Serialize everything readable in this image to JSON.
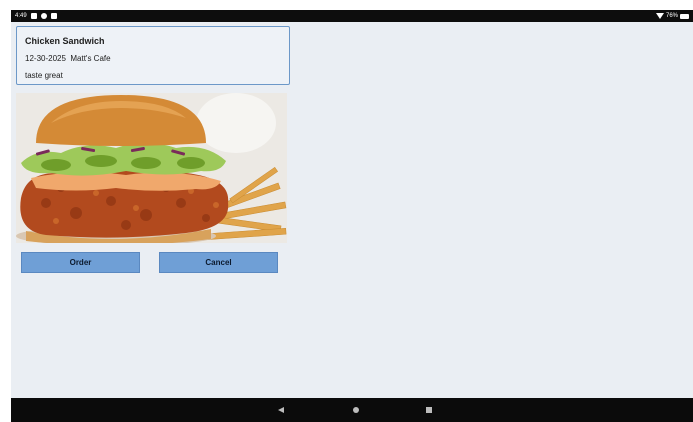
{
  "status_bar": {
    "time": "4:49",
    "battery": "76%",
    "icons": [
      "download-icon",
      "settings-icon",
      "notification-icon",
      "wifi-icon",
      "battery-icon"
    ]
  },
  "item": {
    "title": "Chicken Sandwich",
    "date": "12-30-2025",
    "place": "Matt's Cafe",
    "description": "taste great",
    "image_subject": "chicken-sandwich-with-fries"
  },
  "actions": {
    "order_label": "Order",
    "cancel_label": "Cancel"
  },
  "nav": {
    "icons": [
      "back-icon",
      "home-icon",
      "recents-icon"
    ]
  },
  "colors": {
    "background": "#eaeef3",
    "card_border": "#6c98c8",
    "button": "#6f9fd6",
    "bars": "#0b0b0b"
  }
}
